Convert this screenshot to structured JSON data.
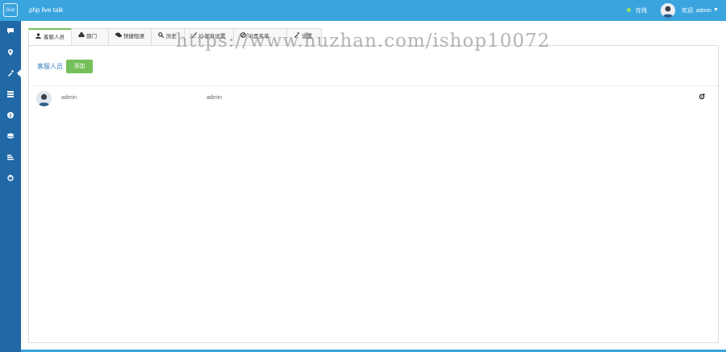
{
  "header": {
    "logo_text": "live",
    "app_title": "php live talk",
    "status": "在线",
    "welcome": "欢迎, admin",
    "status_color": "#9ce05a",
    "header_color": "#3aa4de",
    "sidebar_color": "#2168a6"
  },
  "sidebar": {
    "items": [
      {
        "icon": "chat-icon"
      },
      {
        "icon": "location-icon"
      },
      {
        "icon": "wrench-icon",
        "active": true
      },
      {
        "icon": "list-icon"
      },
      {
        "icon": "info-icon"
      },
      {
        "icon": "stack-icon"
      },
      {
        "icon": "chart-icon"
      },
      {
        "icon": "power-icon"
      }
    ]
  },
  "tabs": [
    {
      "label": "客服人员",
      "icon": "user-icon",
      "active": true
    },
    {
      "label": "部门",
      "icon": "group-icon"
    },
    {
      "label": "快捷短语",
      "icon": "comments-icon"
    },
    {
      "label": "历史",
      "icon": "search-icon"
    },
    {
      "label": "小部件设置",
      "icon": "brush-icon"
    },
    {
      "label": "IP黑名单",
      "icon": "ban-icon"
    },
    {
      "label": "设置",
      "icon": "wrench-icon"
    }
  ],
  "main": {
    "section_label": "客服人员",
    "add_button": "添加",
    "accent_color": "#74c05a",
    "rows": [
      {
        "name": "admin",
        "nickname": "admin"
      }
    ]
  },
  "watermark": "https://www.huzhan.com/ishop10072"
}
